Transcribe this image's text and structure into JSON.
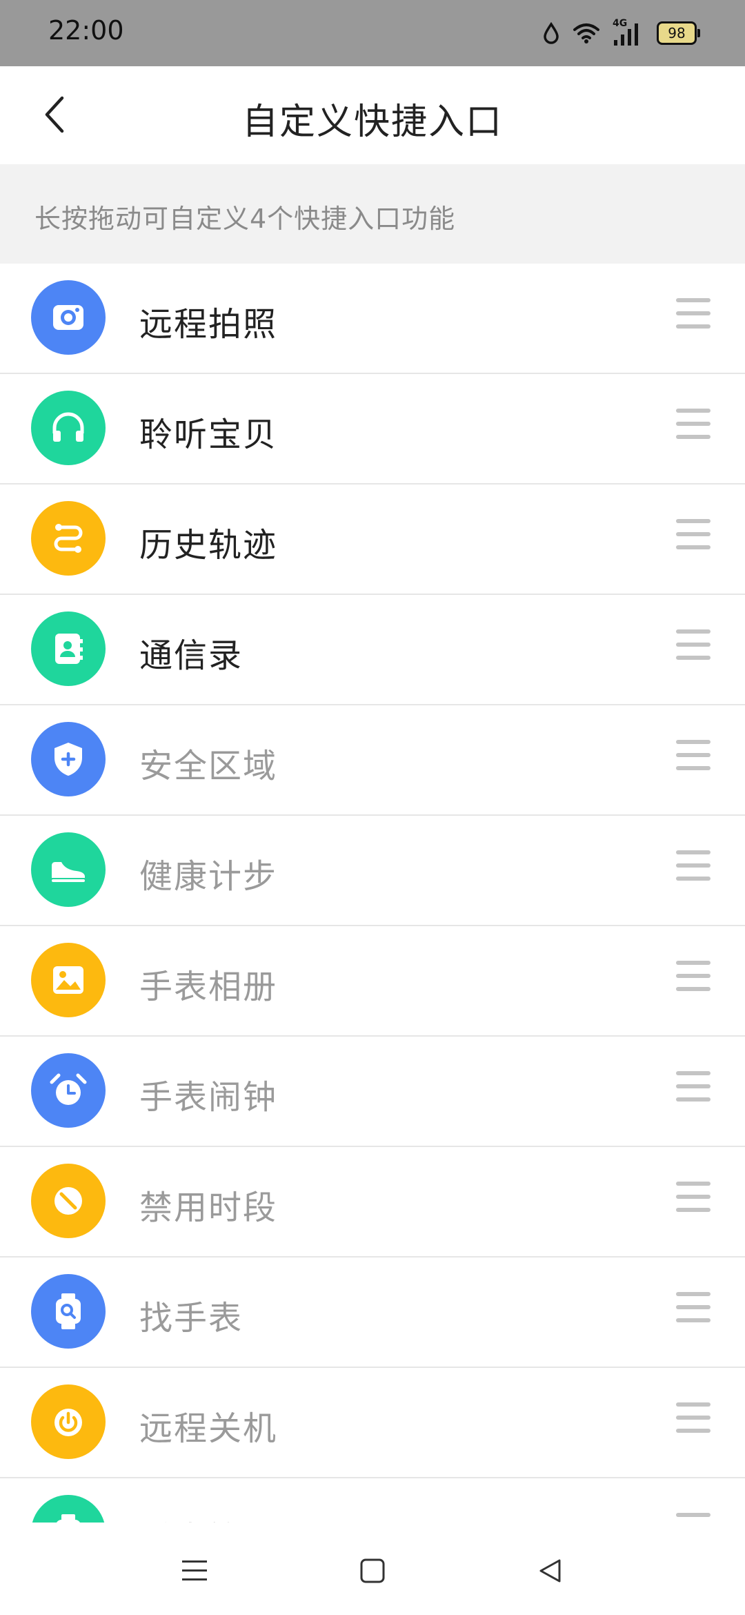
{
  "status_bar": {
    "time": "22:00",
    "network": "4G",
    "battery": "98"
  },
  "header": {
    "title": "自定义快捷入口"
  },
  "hint": "长按拖动可自定义4个快捷入口功能",
  "colors": {
    "blue": "#4d85f5",
    "green": "#1fd69c",
    "orange": "#fdb90f",
    "active_text": "#222222",
    "inactive_text": "#9a9a9a"
  },
  "items": [
    {
      "label": "远程拍照",
      "icon": "camera-icon",
      "color": "blue",
      "active": true
    },
    {
      "label": "聆听宝贝",
      "icon": "headphones-icon",
      "color": "green",
      "active": true
    },
    {
      "label": "历史轨迹",
      "icon": "route-icon",
      "color": "orange",
      "active": true
    },
    {
      "label": "通信录",
      "icon": "contacts-icon",
      "color": "green",
      "active": true
    },
    {
      "label": "安全区域",
      "icon": "shield-icon",
      "color": "blue",
      "active": false
    },
    {
      "label": "健康计步",
      "icon": "shoe-icon",
      "color": "green",
      "active": false
    },
    {
      "label": "手表相册",
      "icon": "photo-album-icon",
      "color": "orange",
      "active": false
    },
    {
      "label": "手表闹钟",
      "icon": "alarm-clock-icon",
      "color": "blue",
      "active": false
    },
    {
      "label": "禁用时段",
      "icon": "forbidden-icon",
      "color": "orange",
      "active": false
    },
    {
      "label": "找手表",
      "icon": "find-watch-icon",
      "color": "blue",
      "active": false
    },
    {
      "label": "远程关机",
      "icon": "power-icon",
      "color": "orange",
      "active": false
    },
    {
      "label": "手表管理",
      "icon": "settings-icon",
      "color": "green",
      "active": false
    }
  ]
}
